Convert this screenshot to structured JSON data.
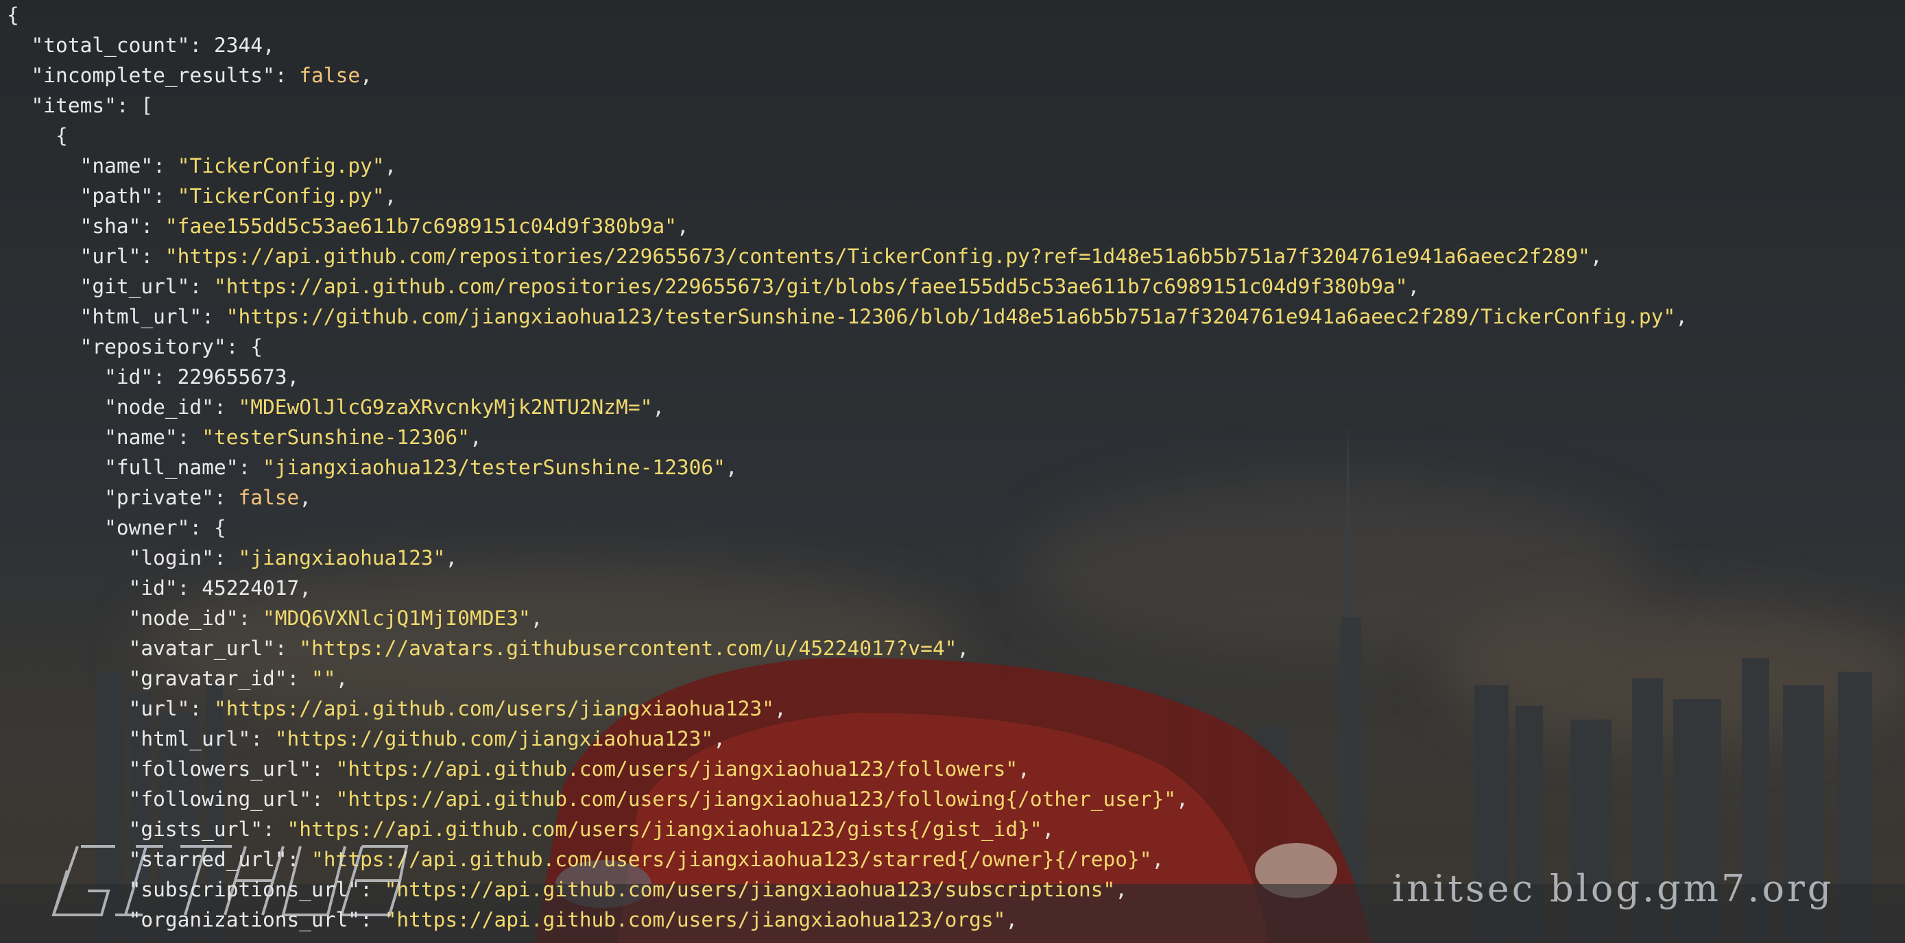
{
  "lines": [
    {
      "i": 0,
      "parts": [
        {
          "t": "{",
          "c": "p"
        }
      ]
    },
    {
      "i": 1,
      "parts": [
        {
          "t": "\"total_count\"",
          "c": "k"
        },
        {
          "t": ": ",
          "c": "p"
        },
        {
          "t": "2344",
          "c": "n"
        },
        {
          "t": ",",
          "c": "p"
        }
      ]
    },
    {
      "i": 1,
      "parts": [
        {
          "t": "\"incomplete_results\"",
          "c": "k"
        },
        {
          "t": ": ",
          "c": "p"
        },
        {
          "t": "false",
          "c": "b"
        },
        {
          "t": ",",
          "c": "p"
        }
      ]
    },
    {
      "i": 1,
      "parts": [
        {
          "t": "\"items\"",
          "c": "k"
        },
        {
          "t": ": [",
          "c": "p"
        }
      ]
    },
    {
      "i": 2,
      "parts": [
        {
          "t": "{",
          "c": "p"
        }
      ]
    },
    {
      "i": 3,
      "parts": [
        {
          "t": "\"name\"",
          "c": "k"
        },
        {
          "t": ": ",
          "c": "p"
        },
        {
          "t": "\"TickerConfig.py\"",
          "c": "s"
        },
        {
          "t": ",",
          "c": "p"
        }
      ]
    },
    {
      "i": 3,
      "parts": [
        {
          "t": "\"path\"",
          "c": "k"
        },
        {
          "t": ": ",
          "c": "p"
        },
        {
          "t": "\"TickerConfig.py\"",
          "c": "s"
        },
        {
          "t": ",",
          "c": "p"
        }
      ]
    },
    {
      "i": 3,
      "parts": [
        {
          "t": "\"sha\"",
          "c": "k"
        },
        {
          "t": ": ",
          "c": "p"
        },
        {
          "t": "\"faee155dd5c53ae611b7c6989151c04d9f380b9a\"",
          "c": "s"
        },
        {
          "t": ",",
          "c": "p"
        }
      ]
    },
    {
      "i": 3,
      "parts": [
        {
          "t": "\"url\"",
          "c": "k"
        },
        {
          "t": ": ",
          "c": "p"
        },
        {
          "t": "\"https://api.github.com/repositories/229655673/contents/TickerConfig.py?ref=1d48e51a6b5b751a7f3204761e941a6aeec2f289\"",
          "c": "s"
        },
        {
          "t": ",",
          "c": "p"
        }
      ]
    },
    {
      "i": 3,
      "parts": [
        {
          "t": "\"git_url\"",
          "c": "k"
        },
        {
          "t": ": ",
          "c": "p"
        },
        {
          "t": "\"https://api.github.com/repositories/229655673/git/blobs/faee155dd5c53ae611b7c6989151c04d9f380b9a\"",
          "c": "s"
        },
        {
          "t": ",",
          "c": "p"
        }
      ]
    },
    {
      "i": 3,
      "parts": [
        {
          "t": "\"html_url\"",
          "c": "k"
        },
        {
          "t": ": ",
          "c": "p"
        },
        {
          "t": "\"https://github.com/jiangxiaohua123/testerSunshine-12306/blob/1d48e51a6b5b751a7f3204761e941a6aeec2f289/TickerConfig.py\"",
          "c": "s"
        },
        {
          "t": ",",
          "c": "p"
        }
      ]
    },
    {
      "i": 3,
      "parts": [
        {
          "t": "\"repository\"",
          "c": "k"
        },
        {
          "t": ": {",
          "c": "p"
        }
      ]
    },
    {
      "i": 4,
      "parts": [
        {
          "t": "\"id\"",
          "c": "k"
        },
        {
          "t": ": ",
          "c": "p"
        },
        {
          "t": "229655673",
          "c": "n"
        },
        {
          "t": ",",
          "c": "p"
        }
      ]
    },
    {
      "i": 4,
      "parts": [
        {
          "t": "\"node_id\"",
          "c": "k"
        },
        {
          "t": ": ",
          "c": "p"
        },
        {
          "t": "\"MDEwOlJlcG9zaXRvcnkyMjk2NTU2NzM=\"",
          "c": "s"
        },
        {
          "t": ",",
          "c": "p"
        }
      ]
    },
    {
      "i": 4,
      "parts": [
        {
          "t": "\"name\"",
          "c": "k"
        },
        {
          "t": ": ",
          "c": "p"
        },
        {
          "t": "\"testerSunshine-12306\"",
          "c": "s"
        },
        {
          "t": ",",
          "c": "p"
        }
      ]
    },
    {
      "i": 4,
      "parts": [
        {
          "t": "\"full_name\"",
          "c": "k"
        },
        {
          "t": ": ",
          "c": "p"
        },
        {
          "t": "\"jiangxiaohua123/testerSunshine-12306\"",
          "c": "s"
        },
        {
          "t": ",",
          "c": "p"
        }
      ]
    },
    {
      "i": 4,
      "parts": [
        {
          "t": "\"private\"",
          "c": "k"
        },
        {
          "t": ": ",
          "c": "p"
        },
        {
          "t": "false",
          "c": "b"
        },
        {
          "t": ",",
          "c": "p"
        }
      ]
    },
    {
      "i": 4,
      "parts": [
        {
          "t": "\"owner\"",
          "c": "k"
        },
        {
          "t": ": {",
          "c": "p"
        }
      ]
    },
    {
      "i": 5,
      "parts": [
        {
          "t": "\"login\"",
          "c": "k"
        },
        {
          "t": ": ",
          "c": "p"
        },
        {
          "t": "\"jiangxiaohua123\"",
          "c": "s"
        },
        {
          "t": ",",
          "c": "p"
        }
      ]
    },
    {
      "i": 5,
      "parts": [
        {
          "t": "\"id\"",
          "c": "k"
        },
        {
          "t": ": ",
          "c": "p"
        },
        {
          "t": "45224017",
          "c": "n"
        },
        {
          "t": ",",
          "c": "p"
        }
      ]
    },
    {
      "i": 5,
      "parts": [
        {
          "t": "\"node_id\"",
          "c": "k"
        },
        {
          "t": ": ",
          "c": "p"
        },
        {
          "t": "\"MDQ6VXNlcjQ1MjI0MDE3\"",
          "c": "s"
        },
        {
          "t": ",",
          "c": "p"
        }
      ]
    },
    {
      "i": 5,
      "parts": [
        {
          "t": "\"avatar_url\"",
          "c": "k"
        },
        {
          "t": ": ",
          "c": "p"
        },
        {
          "t": "\"https://avatars.githubusercontent.com/u/45224017?v=4\"",
          "c": "s"
        },
        {
          "t": ",",
          "c": "p"
        }
      ]
    },
    {
      "i": 5,
      "parts": [
        {
          "t": "\"gravatar_id\"",
          "c": "k"
        },
        {
          "t": ": ",
          "c": "p"
        },
        {
          "t": "\"\"",
          "c": "s"
        },
        {
          "t": ",",
          "c": "p"
        }
      ]
    },
    {
      "i": 5,
      "parts": [
        {
          "t": "\"url\"",
          "c": "k"
        },
        {
          "t": ": ",
          "c": "p"
        },
        {
          "t": "\"https://api.github.com/users/jiangxiaohua123\"",
          "c": "s"
        },
        {
          "t": ",",
          "c": "p"
        }
      ]
    },
    {
      "i": 5,
      "parts": [
        {
          "t": "\"html_url\"",
          "c": "k"
        },
        {
          "t": ": ",
          "c": "p"
        },
        {
          "t": "\"https://github.com/jiangxiaohua123\"",
          "c": "s"
        },
        {
          "t": ",",
          "c": "p"
        }
      ]
    },
    {
      "i": 5,
      "parts": [
        {
          "t": "\"followers_url\"",
          "c": "k"
        },
        {
          "t": ": ",
          "c": "p"
        },
        {
          "t": "\"https://api.github.com/users/jiangxiaohua123/followers\"",
          "c": "s"
        },
        {
          "t": ",",
          "c": "p"
        }
      ]
    },
    {
      "i": 5,
      "parts": [
        {
          "t": "\"following_url\"",
          "c": "k"
        },
        {
          "t": ": ",
          "c": "p"
        },
        {
          "t": "\"https://api.github.com/users/jiangxiaohua123/following{/other_user}\"",
          "c": "s"
        },
        {
          "t": ",",
          "c": "p"
        }
      ]
    },
    {
      "i": 5,
      "parts": [
        {
          "t": "\"gists_url\"",
          "c": "k"
        },
        {
          "t": ": ",
          "c": "p"
        },
        {
          "t": "\"https://api.github.com/users/jiangxiaohua123/gists{/gist_id}\"",
          "c": "s"
        },
        {
          "t": ",",
          "c": "p"
        }
      ]
    },
    {
      "i": 5,
      "parts": [
        {
          "t": "\"starred_url\"",
          "c": "k"
        },
        {
          "t": ": ",
          "c": "p"
        },
        {
          "t": "\"https://api.github.com/users/jiangxiaohua123/starred{/owner}{/repo}\"",
          "c": "s"
        },
        {
          "t": ",",
          "c": "p"
        }
      ]
    },
    {
      "i": 5,
      "parts": [
        {
          "t": "\"subscriptions_url\"",
          "c": "k"
        },
        {
          "t": ": ",
          "c": "p"
        },
        {
          "t": "\"https://api.github.com/users/jiangxiaohua123/subscriptions\"",
          "c": "s"
        },
        {
          "t": ",",
          "c": "p"
        }
      ]
    },
    {
      "i": 5,
      "parts": [
        {
          "t": "\"organizations_url\"",
          "c": "k"
        },
        {
          "t": ": ",
          "c": "p"
        },
        {
          "t": "\"https://api.github.com/users/jiangxiaohua123/orgs\"",
          "c": "s"
        },
        {
          "t": ",",
          "c": "p"
        }
      ]
    }
  ],
  "watermark": {
    "logo_text": "GITHUB",
    "right_text": "initsec blog.gm7.org"
  },
  "colors": {
    "key": "#e9e9e9",
    "string": "#f1d96d",
    "boolean": "#f3c27a",
    "number": "#e9e9e9"
  }
}
